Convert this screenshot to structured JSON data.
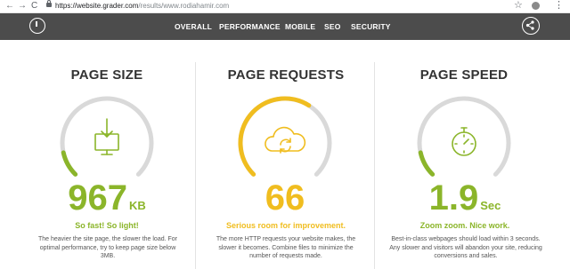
{
  "browser": {
    "back_glyph": "←",
    "forward_glyph": "→",
    "reload_glyph": "C",
    "url_main": "https://website.grader.com",
    "url_path": "/results/www.rodiahamir.com",
    "star_glyph": "☆",
    "menu_glyph": "⋮"
  },
  "nav": {
    "items": [
      "OVERALL",
      "PERFORMANCE",
      "MOBILE",
      "SEO",
      "SECURITY"
    ]
  },
  "metrics": [
    {
      "title": "PAGE SIZE",
      "value": "967",
      "unit": "KB",
      "tagline": "So fast! So light!",
      "description": "The heavier the site page, the slower the load. For optimal performance, try to keep page size below 3MB.",
      "gauge_fraction": 0.12,
      "color": "#8bb52a",
      "icon": "download-monitor-icon"
    },
    {
      "title": "PAGE REQUESTS",
      "value": "66",
      "unit": "",
      "tagline": "Serious room for improvement.",
      "description": "The more HTTP requests your website makes, the slower it becomes. Combine files to minimize the number of requests made.",
      "gauge_fraction": 0.62,
      "color": "#f0bd1f",
      "icon": "cloud-sync-icon"
    },
    {
      "title": "PAGE SPEED",
      "value": "1.9",
      "unit": "Sec",
      "tagline": "Zoom zoom. Nice work.",
      "description": "Best-in-class webpages should load within 3 seconds. Any slower and visitors will abandon your site, reducing conversions and sales.",
      "gauge_fraction": 0.12,
      "color": "#8bb52a",
      "icon": "stopwatch-icon"
    }
  ],
  "colors": {
    "track": "#d9d9d9",
    "nav_bg": "#4c4c4c"
  }
}
